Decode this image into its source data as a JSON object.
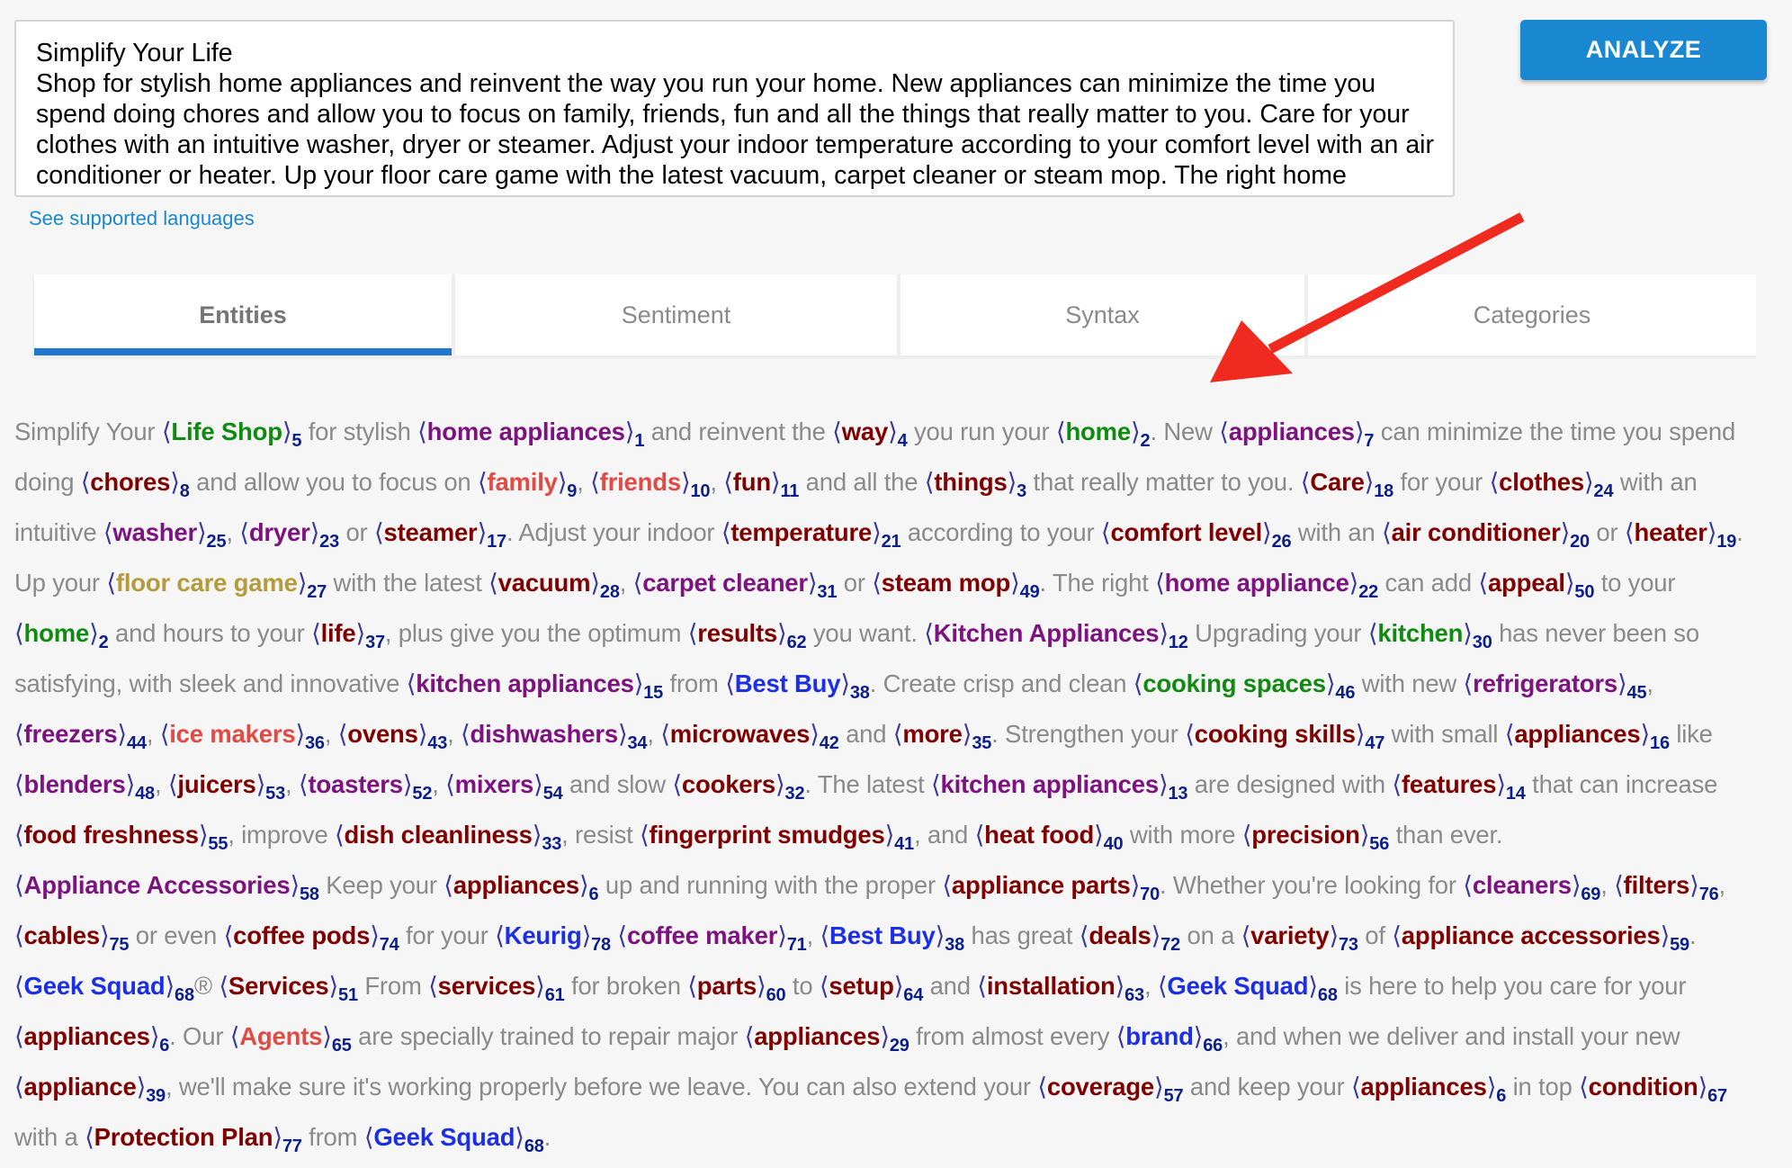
{
  "input": {
    "value": "Simplify Your Life\nShop for stylish home appliances and reinvent the way you run your home. New appliances can minimize the time you spend doing chores and allow you to focus on family, friends, fun and all the things that really matter to you. Care for your clothes with an intuitive washer, dryer or steamer. Adjust your indoor temperature according to your comfort level with an air conditioner or heater. Up your floor care game with the latest vacuum, carpet cleaner or steam mop. The right home appliance can add appeal to your home and hours to your life, plus give you the optimum results you want."
  },
  "analyze_button": {
    "label": "ANALYZE"
  },
  "languages_link": {
    "label": "See supported languages"
  },
  "tabs": [
    {
      "label": "Entities",
      "active": true
    },
    {
      "label": "Sentiment",
      "active": false
    },
    {
      "label": "Syntax",
      "active": false
    },
    {
      "label": "Categories",
      "active": false
    }
  ],
  "annotation": {
    "arrow_color": "#f02a1f"
  },
  "entity_colors": {
    "green": "#118a11",
    "purple": "#7d1281",
    "maroon": "#800000",
    "red": "#e34a44",
    "blue": "#1b2ee8",
    "gold": "#b59b3d",
    "index": "#0b1f8c"
  },
  "segments": [
    {
      "t": "Simplify Your "
    },
    {
      "e": "Life Shop",
      "n": "5",
      "c": "green"
    },
    {
      "t": " for stylish "
    },
    {
      "e": "home appliances",
      "n": "1",
      "c": "purple"
    },
    {
      "t": " and reinvent the "
    },
    {
      "e": "way",
      "n": "4",
      "c": "maroon"
    },
    {
      "t": " you run your "
    },
    {
      "e": "home",
      "n": "2",
      "c": "green"
    },
    {
      "t": ". New "
    },
    {
      "e": "appliances",
      "n": "7",
      "c": "purple"
    },
    {
      "t": " can minimize the time you spend doing "
    },
    {
      "e": "chores",
      "n": "8",
      "c": "maroon"
    },
    {
      "t": " and allow you to focus on "
    },
    {
      "e": "family",
      "n": "9",
      "c": "red"
    },
    {
      "t": ", "
    },
    {
      "e": "friends",
      "n": "10",
      "c": "red"
    },
    {
      "t": ", "
    },
    {
      "e": "fun",
      "n": "11",
      "c": "maroon"
    },
    {
      "t": " and all the "
    },
    {
      "e": "things",
      "n": "3",
      "c": "maroon"
    },
    {
      "t": " that really matter to you. "
    },
    {
      "e": "Care",
      "n": "18",
      "c": "maroon"
    },
    {
      "t": " for your "
    },
    {
      "e": "clothes",
      "n": "24",
      "c": "maroon"
    },
    {
      "t": " with an intuitive "
    },
    {
      "e": "washer",
      "n": "25",
      "c": "purple"
    },
    {
      "t": ", "
    },
    {
      "e": "dryer",
      "n": "23",
      "c": "purple"
    },
    {
      "t": " or "
    },
    {
      "e": "steamer",
      "n": "17",
      "c": "maroon"
    },
    {
      "t": ". Adjust your indoor "
    },
    {
      "e": "temperature",
      "n": "21",
      "c": "maroon"
    },
    {
      "t": " according to your "
    },
    {
      "e": "comfort level",
      "n": "26",
      "c": "maroon"
    },
    {
      "t": " with an "
    },
    {
      "e": "air conditioner",
      "n": "20",
      "c": "maroon"
    },
    {
      "t": " or "
    },
    {
      "e": "heater",
      "n": "19",
      "c": "maroon"
    },
    {
      "t": ". Up your "
    },
    {
      "e": "floor care game",
      "n": "27",
      "c": "gold"
    },
    {
      "t": " with the latest "
    },
    {
      "e": "vacuum",
      "n": "28",
      "c": "maroon"
    },
    {
      "t": ", "
    },
    {
      "e": "carpet cleaner",
      "n": "31",
      "c": "purple"
    },
    {
      "t": " or "
    },
    {
      "e": "steam mop",
      "n": "49",
      "c": "maroon"
    },
    {
      "t": ". The right "
    },
    {
      "e": "home appliance",
      "n": "22",
      "c": "purple"
    },
    {
      "t": " can add "
    },
    {
      "e": "appeal",
      "n": "50",
      "c": "maroon"
    },
    {
      "t": " to your "
    },
    {
      "e": "home",
      "n": "2",
      "c": "green"
    },
    {
      "t": " and hours to your "
    },
    {
      "e": "life",
      "n": "37",
      "c": "maroon"
    },
    {
      "t": ", plus give you the optimum "
    },
    {
      "e": "results",
      "n": "62",
      "c": "maroon"
    },
    {
      "t": " you want. "
    },
    {
      "e": "Kitchen Appliances",
      "n": "12",
      "c": "purple"
    },
    {
      "t": " Upgrading your "
    },
    {
      "e": "kitchen",
      "n": "30",
      "c": "green"
    },
    {
      "t": " has never been so satisfying, with sleek and innovative "
    },
    {
      "e": "kitchen appliances",
      "n": "15",
      "c": "purple"
    },
    {
      "t": " from "
    },
    {
      "e": "Best Buy",
      "n": "38",
      "c": "blue"
    },
    {
      "t": ". Create crisp and clean "
    },
    {
      "e": "cooking spaces",
      "n": "46",
      "c": "green"
    },
    {
      "t": " with new "
    },
    {
      "e": "refrigerators",
      "n": "45",
      "c": "purple"
    },
    {
      "t": ", "
    },
    {
      "e": "freezers",
      "n": "44",
      "c": "purple"
    },
    {
      "t": ", "
    },
    {
      "e": "ice makers",
      "n": "36",
      "c": "red"
    },
    {
      "t": ", "
    },
    {
      "e": "ovens",
      "n": "43",
      "c": "maroon"
    },
    {
      "t": ", "
    },
    {
      "e": "dishwashers",
      "n": "34",
      "c": "purple"
    },
    {
      "t": ", "
    },
    {
      "e": "microwaves",
      "n": "42",
      "c": "maroon"
    },
    {
      "t": " and "
    },
    {
      "e": "more",
      "n": "35",
      "c": "maroon"
    },
    {
      "t": ". Strengthen your "
    },
    {
      "e": "cooking skills",
      "n": "47",
      "c": "maroon"
    },
    {
      "t": " with small "
    },
    {
      "e": "appliances",
      "n": "16",
      "c": "maroon"
    },
    {
      "t": " like "
    },
    {
      "e": "blenders",
      "n": "48",
      "c": "purple"
    },
    {
      "t": ", "
    },
    {
      "e": "juicers",
      "n": "53",
      "c": "maroon"
    },
    {
      "t": ", "
    },
    {
      "e": "toasters",
      "n": "52",
      "c": "purple"
    },
    {
      "t": ", "
    },
    {
      "e": "mixers",
      "n": "54",
      "c": "purple"
    },
    {
      "t": " and slow "
    },
    {
      "e": "cookers",
      "n": "32",
      "c": "maroon"
    },
    {
      "t": ". The latest "
    },
    {
      "e": "kitchen appliances",
      "n": "13",
      "c": "purple"
    },
    {
      "t": " are designed with "
    },
    {
      "e": "features",
      "n": "14",
      "c": "maroon"
    },
    {
      "t": " that can increase "
    },
    {
      "e": "food freshness",
      "n": "55",
      "c": "maroon"
    },
    {
      "t": ", improve "
    },
    {
      "e": "dish cleanliness",
      "n": "33",
      "c": "maroon"
    },
    {
      "t": ", resist "
    },
    {
      "e": "fingerprint smudges",
      "n": "41",
      "c": "maroon"
    },
    {
      "t": ", and "
    },
    {
      "e": "heat food",
      "n": "40",
      "c": "maroon"
    },
    {
      "t": " with more "
    },
    {
      "e": "precision",
      "n": "56",
      "c": "maroon"
    },
    {
      "t": " than ever. "
    },
    {
      "e": "Appliance Accessories",
      "n": "58",
      "c": "purple"
    },
    {
      "t": " Keep your "
    },
    {
      "e": "appliances",
      "n": "6",
      "c": "maroon"
    },
    {
      "t": " up and running with the proper "
    },
    {
      "e": "appliance parts",
      "n": "70",
      "c": "maroon"
    },
    {
      "t": ". Whether you're looking for "
    },
    {
      "e": "cleaners",
      "n": "69",
      "c": "purple"
    },
    {
      "t": ", "
    },
    {
      "e": "filters",
      "n": "76",
      "c": "maroon"
    },
    {
      "t": ", "
    },
    {
      "e": "cables",
      "n": "75",
      "c": "maroon"
    },
    {
      "t": " or even "
    },
    {
      "e": "coffee pods",
      "n": "74",
      "c": "maroon"
    },
    {
      "t": " for your "
    },
    {
      "e": "Keurig",
      "n": "78",
      "c": "blue"
    },
    {
      "t": " "
    },
    {
      "e": "coffee maker",
      "n": "71",
      "c": "purple"
    },
    {
      "t": ", "
    },
    {
      "e": "Best Buy",
      "n": "38",
      "c": "blue"
    },
    {
      "t": " has great "
    },
    {
      "e": "deals",
      "n": "72",
      "c": "maroon"
    },
    {
      "t": " on a "
    },
    {
      "e": "variety",
      "n": "73",
      "c": "maroon"
    },
    {
      "t": " of "
    },
    {
      "e": "appliance accessories",
      "n": "59",
      "c": "maroon"
    },
    {
      "t": ". "
    },
    {
      "e": "Geek Squad",
      "n": "68",
      "c": "blue"
    },
    {
      "t": "® "
    },
    {
      "e": "Services",
      "n": "51",
      "c": "maroon"
    },
    {
      "t": " From "
    },
    {
      "e": "services",
      "n": "61",
      "c": "maroon"
    },
    {
      "t": " for broken "
    },
    {
      "e": "parts",
      "n": "60",
      "c": "maroon"
    },
    {
      "t": " to "
    },
    {
      "e": "setup",
      "n": "64",
      "c": "maroon"
    },
    {
      "t": " and "
    },
    {
      "e": "installation",
      "n": "63",
      "c": "maroon"
    },
    {
      "t": ", "
    },
    {
      "e": "Geek Squad",
      "n": "68",
      "c": "blue"
    },
    {
      "t": " is here to help you care for your "
    },
    {
      "e": "appliances",
      "n": "6",
      "c": "maroon"
    },
    {
      "t": ". Our "
    },
    {
      "e": "Agents",
      "n": "65",
      "c": "red"
    },
    {
      "t": " are specially trained to repair major "
    },
    {
      "e": "appliances",
      "n": "29",
      "c": "maroon"
    },
    {
      "t": " from almost every "
    },
    {
      "e": "brand",
      "n": "66",
      "c": "blue"
    },
    {
      "t": ", and when we deliver and install your new "
    },
    {
      "e": "appliance",
      "n": "39",
      "c": "maroon"
    },
    {
      "t": ", we'll make sure it's working properly before we leave. You can also extend your "
    },
    {
      "e": "coverage",
      "n": "57",
      "c": "maroon"
    },
    {
      "t": " and keep your "
    },
    {
      "e": "appliances",
      "n": "6",
      "c": "maroon"
    },
    {
      "t": " in top "
    },
    {
      "e": "condition",
      "n": "67",
      "c": "maroon"
    },
    {
      "t": " with a "
    },
    {
      "e": "Protection Plan",
      "n": "77",
      "c": "maroon"
    },
    {
      "t": " from "
    },
    {
      "e": "Geek Squad",
      "n": "68",
      "c": "blue"
    },
    {
      "t": "."
    }
  ]
}
